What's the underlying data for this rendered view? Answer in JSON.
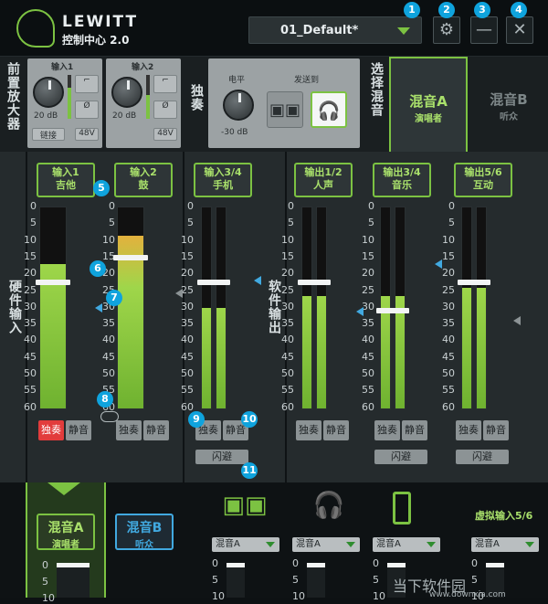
{
  "header": {
    "brand": "LEWITT",
    "subtitle": "控制中心 2.0",
    "preset": "01_Default*"
  },
  "callouts": [
    "1",
    "2",
    "3",
    "4",
    "5",
    "6",
    "7",
    "8",
    "9",
    "10",
    "11"
  ],
  "preamp": {
    "title": "前置放大器",
    "ch1": {
      "label": "输入1",
      "gain": "20 dB",
      "link": "链接",
      "level": 0.7
    },
    "ch2": {
      "label": "输入2",
      "gain": "20 dB",
      "phantom": "48V",
      "level": 0.55
    },
    "ch1_phantom": "48V"
  },
  "solo": {
    "title": "独奏",
    "level_label": "电平",
    "level_value": "-30 dB",
    "send_label": "发送到"
  },
  "select_mix": {
    "title": "选择混音",
    "mixA": {
      "name": "混音A",
      "sub": "演唱者"
    },
    "mixB": {
      "name": "混音B",
      "sub": "听众"
    }
  },
  "hardware_label": "硬件输入",
  "software_label": "软件输出",
  "scale": [
    "0",
    "5",
    "10",
    "15",
    "20",
    "25",
    "30",
    "35",
    "40",
    "45",
    "50",
    "55",
    "60"
  ],
  "channels": [
    {
      "name": "输入1",
      "sub": "吉他",
      "level": 0.72,
      "fader": 0.36,
      "solo": "独奏",
      "mute": "静音"
    },
    {
      "name": "输入2",
      "sub": "鼓",
      "level": 0.86,
      "fader": 0.24,
      "solo": "独奏",
      "mute": "静音"
    },
    {
      "name": "输入3/4",
      "sub": "手机",
      "level": 0.5,
      "fader": 0.36,
      "solo": "独奏",
      "mute": "静音",
      "duck": "闪避"
    },
    {
      "name": "输出1/2",
      "sub": "人声",
      "level": 0.56,
      "fader": 0.36,
      "solo": "独奏",
      "mute": "静音"
    },
    {
      "name": "输出3/4",
      "sub": "音乐",
      "level": 0.56,
      "fader": 0.5,
      "solo": "独奏",
      "mute": "静音",
      "duck": "闪避"
    },
    {
      "name": "输出5/6",
      "sub": "互动",
      "level": 0.6,
      "fader": 0.36,
      "solo": "独奏",
      "mute": "静音",
      "duck": "闪避"
    }
  ],
  "bottom": {
    "mixA": {
      "name": "混音A",
      "sub": "演唱者"
    },
    "mixB": {
      "name": "混音B",
      "sub": "听众"
    },
    "outputs": [
      {
        "icon": "speakers-icon",
        "select": "混音A"
      },
      {
        "icon": "headphones-icon",
        "select": "混音A"
      },
      {
        "icon": "phone-icon",
        "select": "混音A"
      }
    ],
    "virtual": {
      "label": "虚拟输入5/6",
      "select": "混音A"
    },
    "scale": [
      "0",
      "5",
      "10"
    ]
  },
  "watermark": {
    "name": "当下软件园",
    "url": "www.downxia.com"
  },
  "colors": {
    "accent": "#7cc242",
    "callout": "#0fa3dd",
    "solo_on": "#e23c3c"
  }
}
